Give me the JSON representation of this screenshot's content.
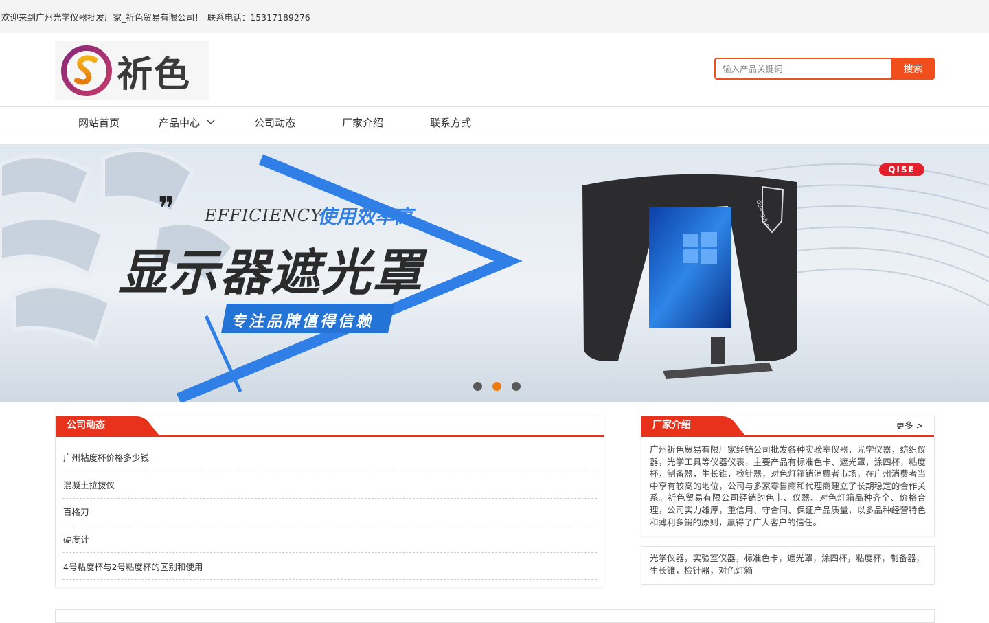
{
  "topbar": {
    "welcome": "欢迎来到广州光学仪器批发厂家_祈色贸易有限公司！",
    "phone": "联系电话：15317189276"
  },
  "header": {
    "logo_text": "祈色",
    "search_placeholder": "输入产品关键词",
    "search_button": "搜索"
  },
  "nav": {
    "items": [
      "网站首页",
      "产品中心",
      "公司动态",
      "厂家介绍",
      "联系方式"
    ]
  },
  "banner": {
    "brand_tag": "QISE",
    "quote_mark": "❞",
    "efficiency": "EFFICIENCY",
    "efficiency_cn": "使用效率高",
    "headline": "显示器遮光罩",
    "tagline": "专注品牌值得信赖",
    "hood_label": "Guangdun",
    "dots_count": 3,
    "active_dot": 1
  },
  "news": {
    "title": "公司动态",
    "items": [
      "广州粘度杯价格多少钱",
      "混凝土拉拔仪",
      "百格刀",
      "硬度计",
      "4号粘度杯与2号粘度杯的区别和使用"
    ]
  },
  "about": {
    "title": "厂家介绍",
    "more": "更多 >",
    "text": "广州祈色贸易有限厂家经销公司批发各种实验室仪器，光学仪器，纺织仪器，光学工具等仪器仪表，主要产品有标准色卡、遮光罩，涂四杯，粘度杯，制备器，生长锥，检针器，对色灯箱销消费者市场，在广州消费者当中享有较高的地位，公司与多家零售商和代理商建立了长期稳定的合作关系。祈色贸易有限公司经销的色卡、仪器、对色灯箱品种齐全、价格合理，公司实力雄厚，重信用、守合同、保证产品质量，以多品种经营特色和薄利多销的原则，赢得了广大客户的信任。"
  },
  "tags": {
    "text": "光学仪器，实验室仪器，标准色卡，遮光罩，涂四杯，粘度杯，制备器，生长锥，检针器，对色灯箱"
  },
  "colors": {
    "accent": "#e9321c",
    "search_orange": "#f04f1d",
    "dot_active": "#f07a12",
    "banner_blue": "#2f7fe6"
  }
}
